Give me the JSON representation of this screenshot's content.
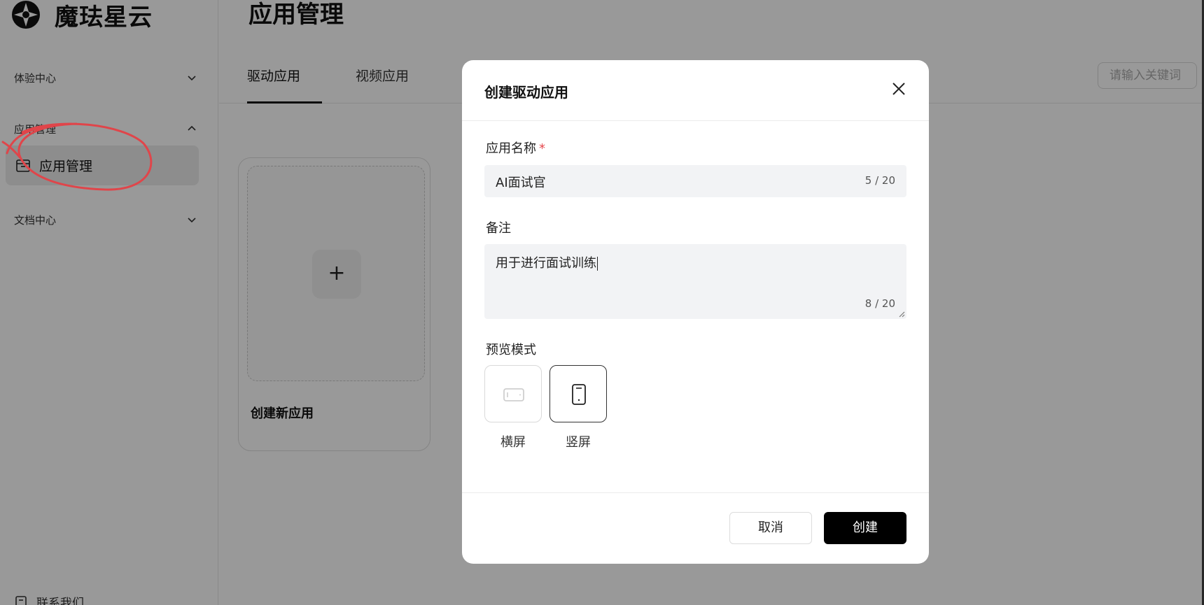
{
  "app": {
    "name": "魔珐星云"
  },
  "sidebar": {
    "groups": [
      {
        "label": "体验中心"
      },
      {
        "label": "应用管理"
      },
      {
        "label": "文档中心"
      }
    ],
    "active_item": {
      "label": "应用管理"
    },
    "bottom_item": {
      "label": "联系我们"
    }
  },
  "main": {
    "title": "应用管理",
    "tabs": [
      {
        "label": "驱动应用"
      },
      {
        "label": "视频应用"
      }
    ],
    "search": {
      "placeholder": "请输入关键词"
    },
    "new_card": {
      "label": "创建新应用",
      "icon": "+"
    }
  },
  "modal": {
    "title": "创建驱动应用",
    "name_field": {
      "label": "应用名称",
      "required_mark": "*",
      "value": "AI面试官",
      "counter": "5 / 20"
    },
    "remark_field": {
      "label": "备注",
      "value": "用于进行面试训练",
      "counter": "8 / 20"
    },
    "preview_mode": {
      "label": "预览模式",
      "options": [
        {
          "label": "横屏",
          "selected": false
        },
        {
          "label": "竖屏",
          "selected": true
        }
      ]
    },
    "buttons": {
      "cancel": "取消",
      "create": "创建"
    }
  },
  "colors": {
    "required": "#e5484d",
    "primary": "#000000",
    "annotation": "#e0454a"
  }
}
